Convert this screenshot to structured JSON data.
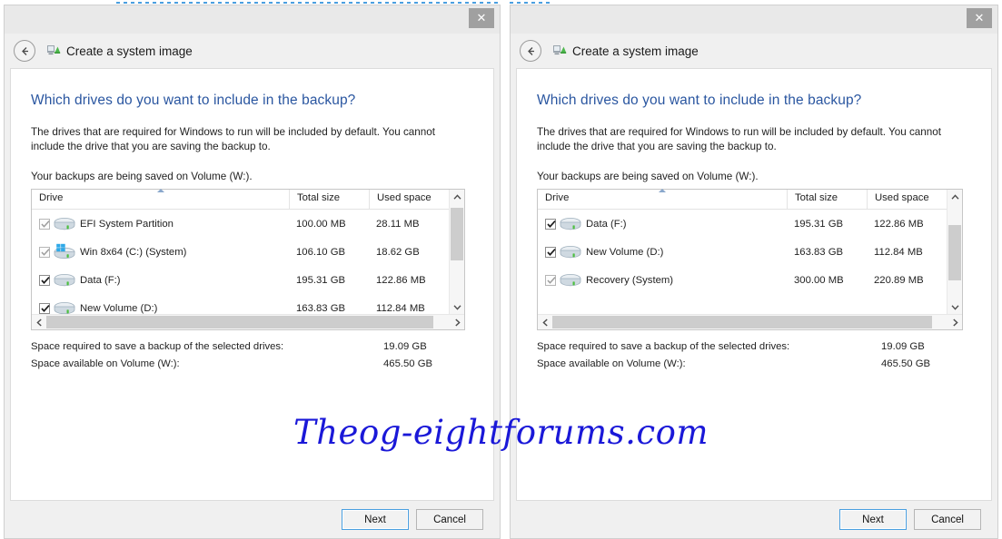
{
  "window": {
    "close_label": "✕",
    "nav_title": "Create a system image",
    "back_icon": "back-arrow-icon",
    "title_icon": "system-image-icon"
  },
  "page": {
    "heading": "Which drives do you want to include in the backup?",
    "description": "The drives that are required for Windows to run will be included by default. You cannot include the drive that you are saving the backup to.",
    "saved_on": "Your backups are being saved on Volume (W:)."
  },
  "table": {
    "columns": [
      "Drive",
      "Total size",
      "Used space"
    ],
    "sort_column": "Drive",
    "sort_direction": "ascending"
  },
  "summary": {
    "required_label": "Space required to save a backup of the selected drives:",
    "required_value": "19.09 GB",
    "available_label": "Space available on Volume (W:):",
    "available_value": "465.50 GB"
  },
  "footer": {
    "next_label": "Next",
    "cancel_label": "Cancel"
  },
  "watermark": {
    "text": "Theog-eightforums.com",
    "color": "#1a18d8"
  },
  "panels": [
    {
      "id": "left",
      "rows": [
        {
          "name": "EFI System Partition",
          "total": "100.00 MB",
          "used": "28.11 MB",
          "checked": true,
          "enabled": false,
          "icon": "hard-drive-icon"
        },
        {
          "name": "Win 8x64 (C:) (System)",
          "total": "106.10 GB",
          "used": "18.62 GB",
          "checked": true,
          "enabled": false,
          "icon": "windows-drive-icon"
        },
        {
          "name": "Data (F:)",
          "total": "195.31 GB",
          "used": "122.86 MB",
          "checked": true,
          "enabled": true,
          "icon": "hard-drive-icon"
        },
        {
          "name": "New Volume (D:)",
          "total": "163.83 GB",
          "used": "112.84 MB",
          "checked": true,
          "enabled": true,
          "icon": "hard-drive-icon"
        }
      ],
      "scroll": {
        "vertical_thumb_top_pct": 4,
        "vertical_thumb_height_pct": 55,
        "horizontal_thumb_width_pct": 96
      }
    },
    {
      "id": "right",
      "rows": [
        {
          "name": "Data (F:)",
          "total": "195.31 GB",
          "used": "122.86 MB",
          "checked": true,
          "enabled": true,
          "icon": "hard-drive-icon"
        },
        {
          "name": "New Volume (D:)",
          "total": "163.83 GB",
          "used": "112.84 MB",
          "checked": true,
          "enabled": true,
          "icon": "hard-drive-icon"
        },
        {
          "name": "Recovery (System)",
          "total": "300.00 MB",
          "used": "220.89 MB",
          "checked": true,
          "enabled": false,
          "icon": "hard-drive-icon"
        }
      ],
      "scroll": {
        "vertical_thumb_top_pct": 22,
        "vertical_thumb_height_pct": 58,
        "horizontal_thumb_width_pct": 96
      }
    }
  ],
  "colors": {
    "heading": "#2a56a0",
    "window_bg": "#f0f0f0",
    "content_bg": "#ffffff",
    "accent": "#4a9fe0"
  }
}
